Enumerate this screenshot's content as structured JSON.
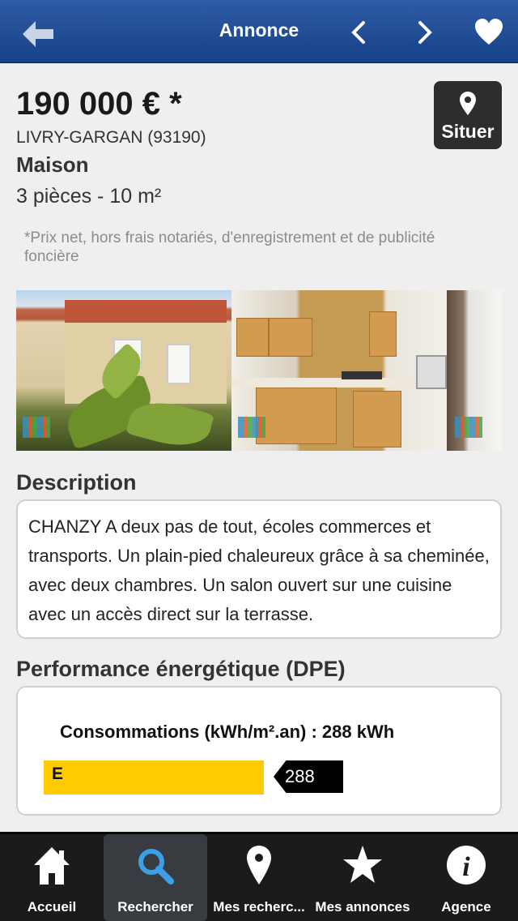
{
  "navbar": {
    "title": "Annonce"
  },
  "listing": {
    "price": "190 000 € *",
    "city": "LIVRY-GARGAN (93190)",
    "type": "Maison",
    "rooms": "3 pièces - 10 m²",
    "locate_label": "Situer",
    "price_note": "*Prix net, hors frais notariés, d'enregistrement et de publicité foncière"
  },
  "description": {
    "title": "Description",
    "text": "CHANZY A deux pas de tout, écoles commerces et transports. Un plain-pied chaleureux grâce à sa cheminée, avec deux chambres. Un salon ouvert sur une cuisine avec un accès direct sur la terrasse."
  },
  "dpe": {
    "title": "Performance énergétique (DPE)",
    "consumption_label": "Consommations (kWh/m².an) : 288 kWh",
    "class_letter": "E",
    "value": "288",
    "class_color": "#fecb00"
  },
  "tabbar": {
    "active_index": 1,
    "tabs": [
      {
        "label": "Accueil",
        "icon": "home-icon"
      },
      {
        "label": "Rechercher",
        "icon": "search-icon"
      },
      {
        "label": "Mes recherc...",
        "icon": "location-pin-icon"
      },
      {
        "label": "Mes annonces",
        "icon": "star-icon"
      },
      {
        "label": "Agence",
        "icon": "info-icon"
      }
    ]
  },
  "colors": {
    "navbar": "#1f4b95",
    "accent": "#3aa0e8",
    "tabbar": "#1b1b1b"
  }
}
